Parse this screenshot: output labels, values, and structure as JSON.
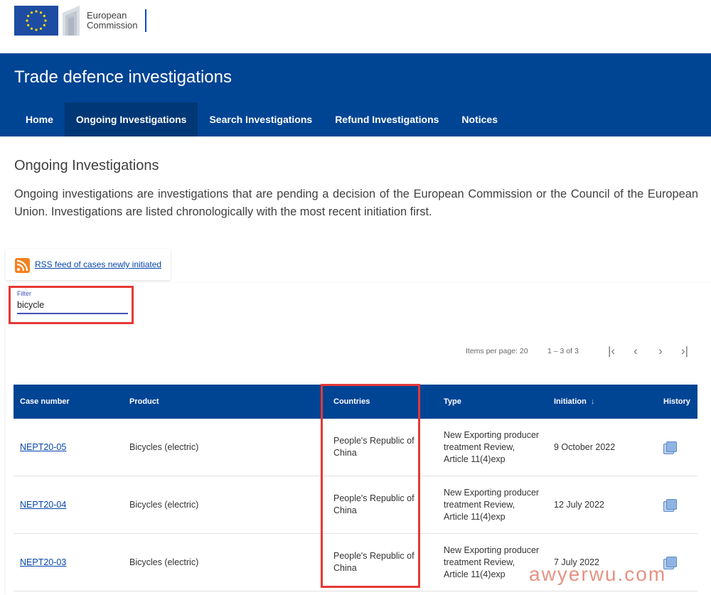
{
  "logo": {
    "line1": "European",
    "line2": "Commission"
  },
  "header": {
    "title": "Trade defence investigations",
    "nav": [
      {
        "label": "Home"
      },
      {
        "label": "Ongoing Investigations"
      },
      {
        "label": "Search Investigations"
      },
      {
        "label": "Refund Investigations"
      },
      {
        "label": "Notices"
      }
    ],
    "active_nav": "Ongoing Investigations",
    "color": "#004494"
  },
  "main": {
    "title": "Ongoing Investigations",
    "intro": "Ongoing investigations are investigations that are pending a decision of the European Commission or the Council of the European Union. Investigations are listed chronologically with the most recent initiation first.",
    "rss_label": "RSS feed of cases newly initiated"
  },
  "filter": {
    "label": "Filter",
    "value": "bicycle"
  },
  "paginator": {
    "items_per_page": "Items per page: 20",
    "range": "1 – 3 of 3",
    "icons": [
      "first-page-icon",
      "previous-page-icon",
      "next-page-icon",
      "last-page-icon"
    ]
  },
  "table": {
    "headers": {
      "case_number": "Case number",
      "product": "Product",
      "countries": "Countries",
      "type": "Type",
      "initiation": "Initiation",
      "history": "History"
    },
    "sort_icon": "arrow-down-icon",
    "rows": [
      {
        "case_number": "NEPT20-05",
        "product": "Bicycles (electric)",
        "countries_l1": "People's Republic of",
        "countries_l2": "China",
        "type_l1": "New Exporting producer",
        "type_l2": "treatment Review,",
        "type_l3": "Article 11(4)exp",
        "initiation": "9 October 2022"
      },
      {
        "case_number": "NEPT20-04",
        "product": "Bicycles (electric)",
        "countries_l1": "People's Republic of",
        "countries_l2": "China",
        "type_l1": "New Exporting producer",
        "type_l2": "treatment Review,",
        "type_l3": "Article 11(4)exp",
        "initiation": "12 July 2022"
      },
      {
        "case_number": "NEPT20-03",
        "product": "Bicycles (electric)",
        "countries_l1": "People's Republic of",
        "countries_l2": "China",
        "type_l1": "New Exporting producer",
        "type_l2": "treatment Review,",
        "type_l3": "Article 11(4)exp",
        "initiation": "7 July 2022"
      }
    ]
  },
  "highlight_color": "#e53935",
  "watermark": "awyerwu.com"
}
